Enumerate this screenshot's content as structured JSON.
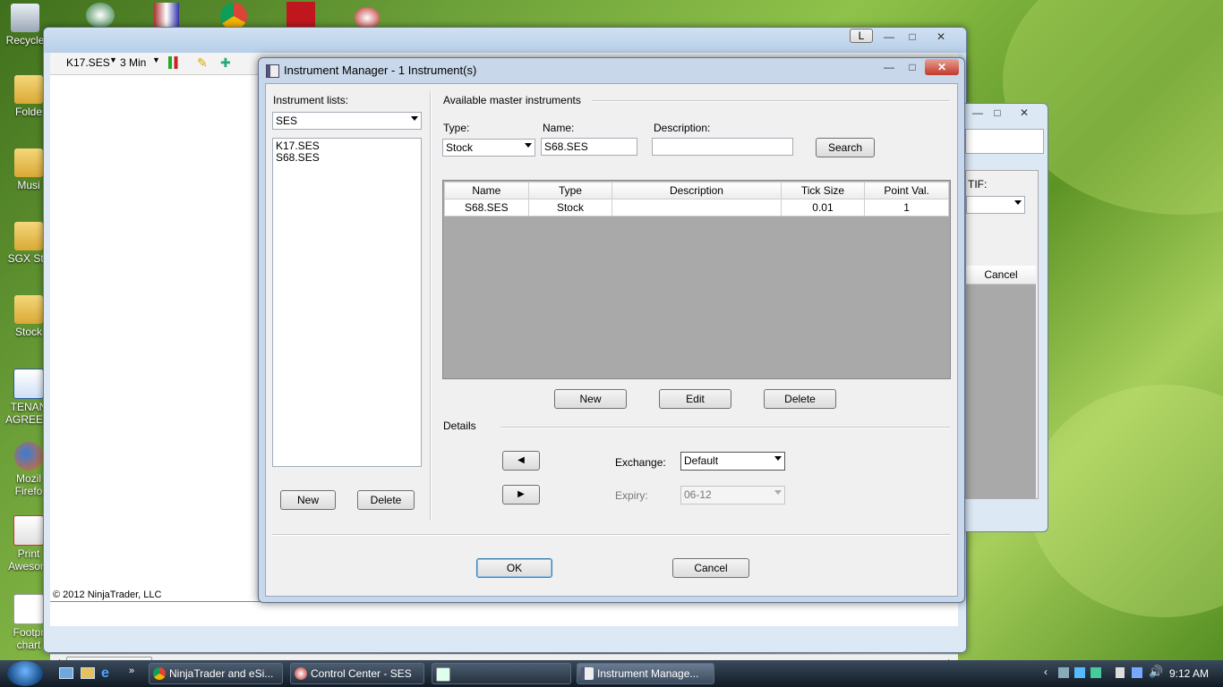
{
  "desktop": {
    "icons": [
      {
        "label": "Recycle"
      },
      {
        "label": "Folde"
      },
      {
        "label": "Musi"
      },
      {
        "label": "SGX Sto"
      },
      {
        "label": "Stock"
      },
      {
        "label": "TENAN AGREEM"
      },
      {
        "label": "Mozil Firefo"
      },
      {
        "label": "Print Awesom"
      },
      {
        "label": "Footpr chart"
      }
    ]
  },
  "chart_window": {
    "instrument": "K17.SES",
    "interval": "3 Min",
    "copyright": "© 2012 NinjaTrader, LLC",
    "minimize": "—",
    "maximize": "□",
    "close": "✕",
    "l_button": "L",
    "scroll_grip": "III"
  },
  "back_window": {
    "tif_label": "TIF:",
    "cancel": "Cancel"
  },
  "dialog": {
    "title": "Instrument Manager - 1 Instrument(s)",
    "instrument_lists_label": "Instrument lists:",
    "selected_list": "SES",
    "list_items": [
      "K17.SES",
      "S68.SES"
    ],
    "list_new": "New",
    "list_delete": "Delete",
    "available_label": "Available master instruments",
    "type_label": "Type:",
    "type_value": "Stock",
    "name_label": "Name:",
    "name_value": "S68.SES",
    "description_label": "Description:",
    "description_value": "",
    "search": "Search",
    "table": {
      "headers": [
        "Name",
        "Type",
        "Description",
        "Tick Size",
        "Point Val."
      ],
      "rows": [
        [
          "S68.SES",
          "Stock",
          "",
          "0.01",
          "1"
        ]
      ]
    },
    "new": "New",
    "edit": "Edit",
    "delete": "Delete",
    "details_label": "Details",
    "exchange_label": "Exchange:",
    "exchange_value": "Default",
    "expiry_label": "Expiry:",
    "expiry_value": "06-12",
    "ok": "OK",
    "cancel": "Cancel"
  },
  "taskbar": {
    "items": [
      {
        "label": "NinjaTrader and eSi..."
      },
      {
        "label": "Control Center - SES"
      },
      {
        "label": ""
      },
      {
        "label": "Instrument Manage..."
      }
    ],
    "clock": "9:12 AM"
  }
}
